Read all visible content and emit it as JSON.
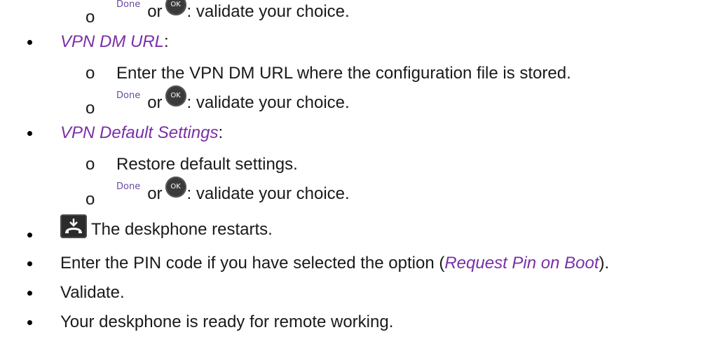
{
  "keys": {
    "done_label": "Done",
    "ok_label": "OK",
    "hangup_icon": "hangup-handset-icon"
  },
  "lines": {
    "or_word": "or",
    "validate_suffix": ": validate your choice.",
    "vpn_dm_url_title": "VPN DM URL",
    "vpn_dm_url_step": "Enter the VPN DM URL where the configuration file is stored.",
    "vpn_default_title": "VPN Default Settings",
    "vpn_default_step": "Restore default settings.",
    "restart_text": "The deskphone restarts.",
    "pin_text_before": "Enter the PIN code if you have selected the option (",
    "pin_option": "Request Pin on Boot",
    "pin_text_after": ").",
    "validate_text": "Validate.",
    "ready_text": "Your deskphone is ready for remote working."
  },
  "colors": {
    "link_purple": "#7a2fa8",
    "key_dark": "#3a3a3a"
  }
}
